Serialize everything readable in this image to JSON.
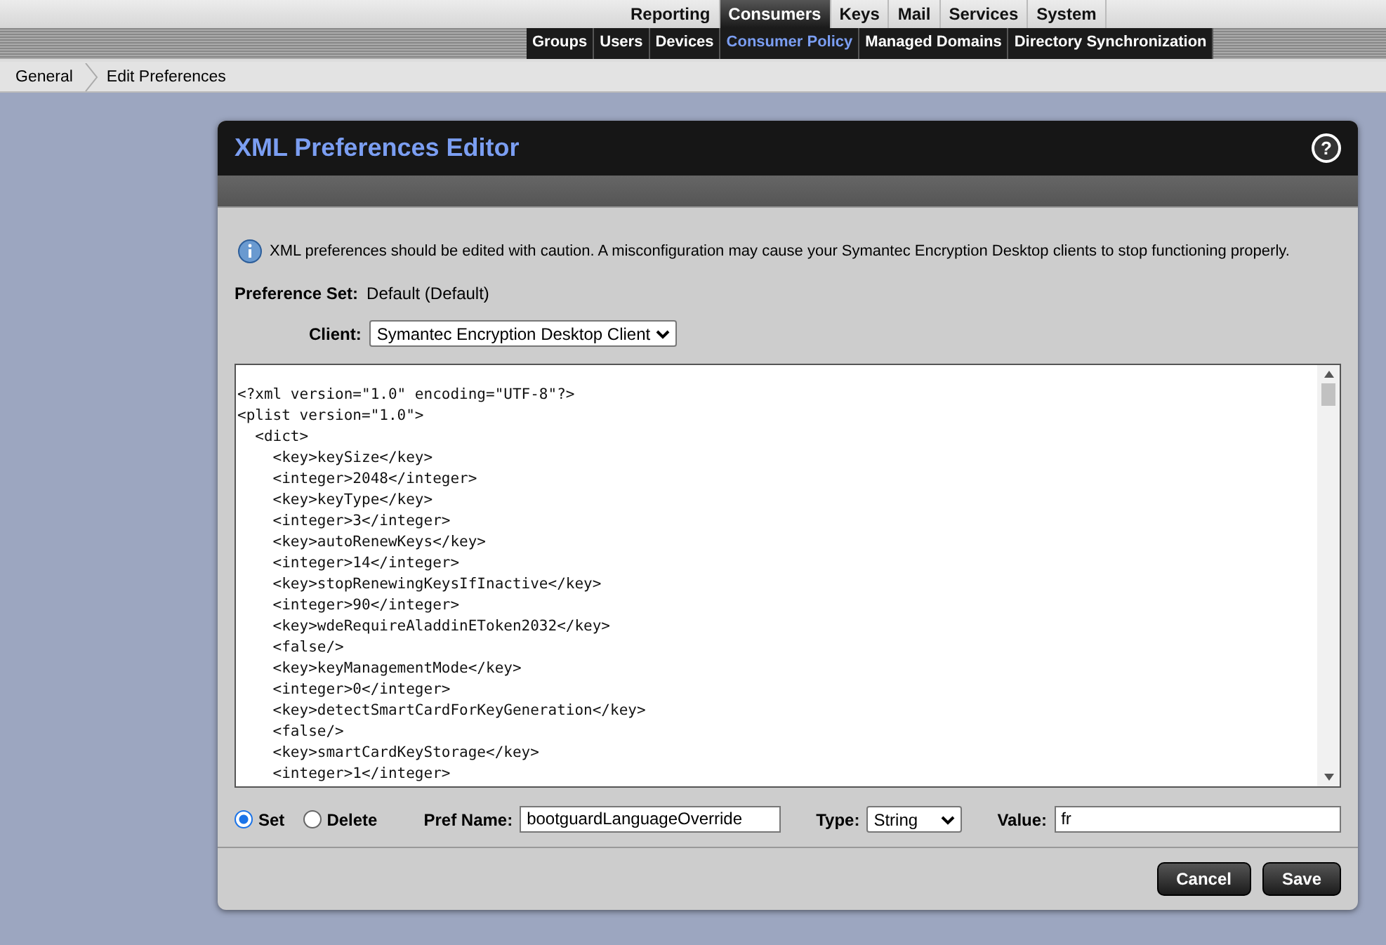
{
  "main_tabs": [
    {
      "label": "Reporting",
      "selected": false
    },
    {
      "label": "Consumers",
      "selected": true
    },
    {
      "label": "Keys",
      "selected": false
    },
    {
      "label": "Mail",
      "selected": false
    },
    {
      "label": "Services",
      "selected": false
    },
    {
      "label": "System",
      "selected": false
    }
  ],
  "sub_tabs": [
    {
      "label": "Groups",
      "selected": false
    },
    {
      "label": "Users",
      "selected": false
    },
    {
      "label": "Devices",
      "selected": false
    },
    {
      "label": "Consumer Policy",
      "selected": true
    },
    {
      "label": "Managed Domains",
      "selected": false
    },
    {
      "label": "Directory Synchronization",
      "selected": false
    }
  ],
  "breadcrumb": [
    "General",
    "Edit Preferences"
  ],
  "dialog": {
    "title": "XML Preferences Editor",
    "help": "?",
    "notice": "XML preferences should be edited with caution. A misconfiguration may cause your Symantec Encryption Desktop clients to stop functioning properly.",
    "preference_set": {
      "label": "Preference Set:",
      "value": "Default (Default)"
    },
    "client": {
      "label": "Client:",
      "value": "Symantec Encryption Desktop Client"
    },
    "xml_lines": [
      "<?xml version=\"1.0\" encoding=\"UTF-8\"?>",
      "<plist version=\"1.0\">",
      "  <dict>",
      "    <key>keySize</key>",
      "    <integer>2048</integer>",
      "    <key>keyType</key>",
      "    <integer>3</integer>",
      "    <key>autoRenewKeys</key>",
      "    <integer>14</integer>",
      "    <key>stopRenewingKeysIfInactive</key>",
      "    <integer>90</integer>",
      "    <key>wdeRequireAladdinEToken2032</key>",
      "    <false/>",
      "    <key>keyManagementMode</key>",
      "    <integer>0</integer>",
      "    <key>detectSmartCardForKeyGeneration</key>",
      "    <false/>",
      "    <key>smartCardKeyStorage</key>",
      "    <integer>1</integer>"
    ],
    "actions": [
      {
        "label": "Set",
        "selected": true
      },
      {
        "label": "Delete",
        "selected": false
      }
    ],
    "pref_name": {
      "label": "Pref Name:",
      "value": "bootguardLanguageOverride"
    },
    "type": {
      "label": "Type:",
      "value": "String"
    },
    "value": {
      "label": "Value:",
      "value": "fr"
    },
    "buttons": [
      "Cancel",
      "Save"
    ]
  }
}
